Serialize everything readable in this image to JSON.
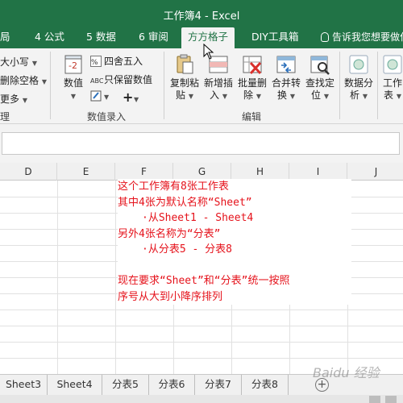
{
  "window": {
    "title": "工作簿4 - Excel"
  },
  "tabs": [
    {
      "label": "局"
    },
    {
      "label": "4 公式"
    },
    {
      "label": "5 数据"
    },
    {
      "label": "6 审阅"
    },
    {
      "label": "方方格子"
    },
    {
      "label": "DIY工具箱"
    }
  ],
  "tell_me": "告诉我您想要做什",
  "ribbon": {
    "left_items": [
      "大小写",
      "删除空格",
      "更多"
    ],
    "left_group": "理",
    "number_btn": "数值",
    "four_five": "四舍五入",
    "keep_value": "只保留数值",
    "group_number": "数值录入",
    "copy_paste_1": "复制粘",
    "copy_paste_2": "贴",
    "new_insert_1": "新增插",
    "new_insert_2": "入",
    "batch_del_1": "批量删",
    "batch_del_2": "除",
    "merge_1": "合并转",
    "merge_2": "换",
    "find_1": "查找定",
    "find_2": "位",
    "group_edit": "编辑",
    "analysis_1": "数据分",
    "analysis_2": "析",
    "work_1": "工作",
    "work_2": "表"
  },
  "columns": [
    "D",
    "E",
    "F",
    "G",
    "H",
    "I",
    "J"
  ],
  "textbox": {
    "line1": "这个工作簿有8张工作表",
    "line2": "其中4张为默认名称“Sheet”",
    "line3": "·从Sheet1 - Sheet4",
    "line4": "另外4张名称为“分表”",
    "line5": "·从分表5 - 分表8",
    "line6": "",
    "line7": "现在要求“Sheet”和“分表”统一按照",
    "line8": "序号从大到小降序排列"
  },
  "sheets": [
    "Sheet3",
    "Sheet4",
    "分表5",
    "分表6",
    "分表7",
    "分表8"
  ],
  "watermark": "Baidu 经验",
  "colors": {
    "excel_green": "#217346",
    "text_red": "#e5121b"
  }
}
